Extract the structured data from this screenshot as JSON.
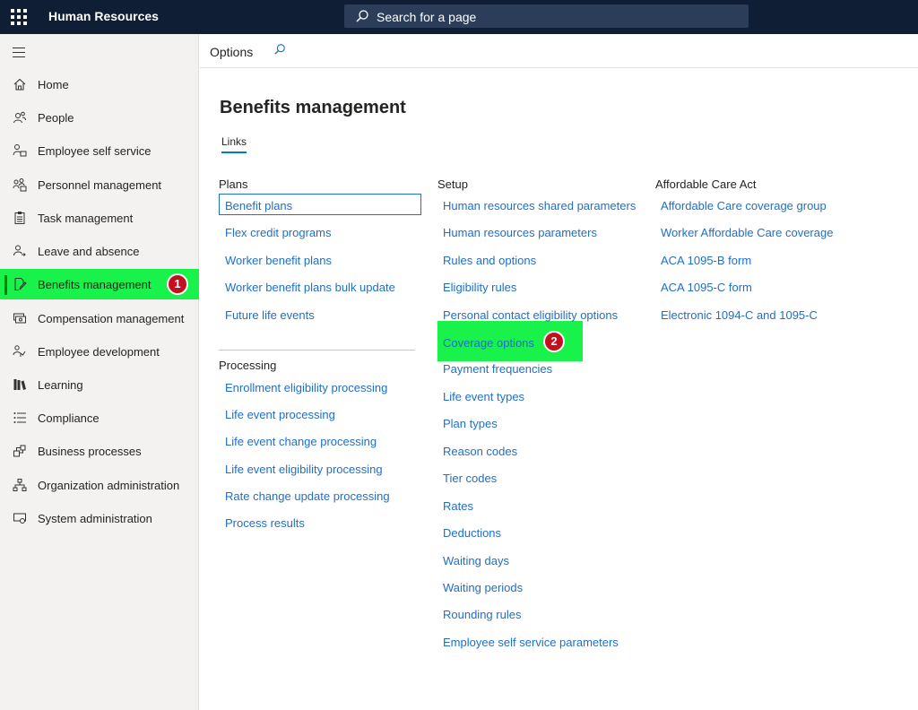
{
  "app": {
    "title": "Human Resources"
  },
  "search": {
    "placeholder": "Search for a page"
  },
  "sidebar": {
    "items": [
      {
        "label": "Home",
        "icon": "home-icon"
      },
      {
        "label": "People",
        "icon": "people-icon"
      },
      {
        "label": "Employee self service",
        "icon": "person-self-service-icon"
      },
      {
        "label": "Personnel management",
        "icon": "people-team-icon"
      },
      {
        "label": "Task management",
        "icon": "clipboard-icon"
      },
      {
        "label": "Leave and absence",
        "icon": "person-leave-icon"
      },
      {
        "label": "Benefits management",
        "icon": "document-edit-icon",
        "active": true
      },
      {
        "label": "Compensation management",
        "icon": "money-icon"
      },
      {
        "label": "Employee development",
        "icon": "person-development-icon"
      },
      {
        "label": "Learning",
        "icon": "books-icon"
      },
      {
        "label": "Compliance",
        "icon": "checklist-icon"
      },
      {
        "label": "Business processes",
        "icon": "process-icon"
      },
      {
        "label": "Organization administration",
        "icon": "org-chart-icon"
      },
      {
        "label": "System administration",
        "icon": "system-admin-icon"
      }
    ]
  },
  "annotations": {
    "badge1": "1",
    "badge2": "2"
  },
  "optionsbar": {
    "label": "Options"
  },
  "page": {
    "title": "Benefits management",
    "tab": "Links"
  },
  "plans": {
    "header": "Plans",
    "links": [
      "Benefit plans",
      "Flex credit programs",
      "Worker benefit plans",
      "Worker benefit plans bulk update",
      "Future life events"
    ]
  },
  "processing": {
    "header": "Processing",
    "links": [
      "Enrollment eligibility processing",
      "Life event processing",
      "Life event change processing",
      "Life event eligibility processing",
      "Rate change update processing",
      "Process results"
    ]
  },
  "setup": {
    "header": "Setup",
    "links": [
      "Human resources shared parameters",
      "Human resources parameters",
      "Rules and options",
      "Eligibility rules",
      "Personal contact eligibility options",
      "Coverage options",
      "Payment frequencies",
      "Life event types",
      "Plan types",
      "Reason codes",
      "Tier codes",
      "Rates",
      "Deductions",
      "Waiting days",
      "Waiting periods",
      "Rounding rules",
      "Employee self service parameters"
    ]
  },
  "aca": {
    "header": "Affordable Care Act",
    "links": [
      "Affordable Care coverage group",
      "Worker Affordable Care coverage",
      "ACA 1095-B form",
      "ACA 1095-C form",
      "Electronic 1094-C and 1095-C"
    ]
  },
  "colors": {
    "topbar": "#0f1e34",
    "highlight": "#19f24a",
    "link": "#1f6fc8",
    "badge": "#c50f1f"
  }
}
